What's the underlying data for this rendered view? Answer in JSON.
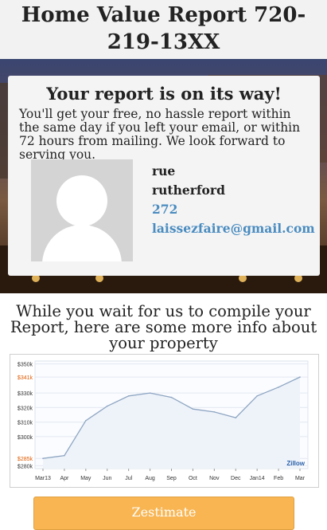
{
  "header": {
    "title": "Home Value Report 720-219-13XX"
  },
  "card": {
    "title": "Your report is on its way!",
    "message": "You'll get your free, no hassle report within the same day if you left your email, or within 72 hours from mailing. We look forward to serving you.",
    "first_name": "rue",
    "last_name": "rutherford",
    "number": "272",
    "email": "laissezfaire@gmail.com"
  },
  "wait_text": "While you wait for us to compile your Report, here are some more info about your property",
  "chart_data": {
    "type": "line",
    "x": [
      "Mar13",
      "Apr",
      "May",
      "Jun",
      "Jul",
      "Aug",
      "Sep",
      "Oct",
      "Nov",
      "Dec",
      "Jan14",
      "Feb",
      "Mar"
    ],
    "series": [
      {
        "values": [
          285,
          287,
          311,
          321,
          328,
          330,
          327,
          319,
          317,
          313,
          328,
          334,
          341
        ]
      }
    ],
    "ylim": [
      278,
      352
    ],
    "yticks": [
      280,
      285,
      300,
      310,
      320,
      330,
      341,
      350
    ],
    "ytick_labels": [
      "$280k",
      "$285k",
      "$300k",
      "$310k",
      "$320k",
      "$330k",
      "$341k",
      "$350k"
    ],
    "highlight_ticks": [
      285,
      341
    ],
    "highlight_color": "#e05a00",
    "line_color": "#8fa6c2",
    "fill_color": "#eef3fa",
    "grid": true,
    "watermark": "Zillow"
  },
  "button": {
    "label": "Zestimate"
  }
}
